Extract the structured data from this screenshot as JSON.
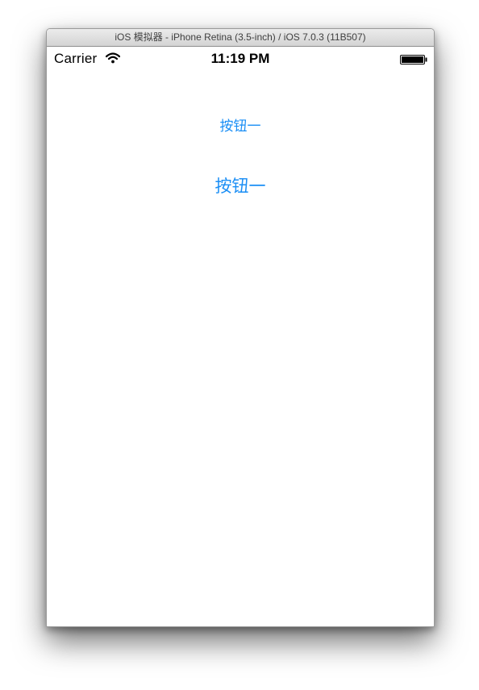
{
  "window": {
    "title": "iOS 模拟器 - iPhone Retina (3.5-inch) / iOS 7.0.3 (11B507)"
  },
  "statusbar": {
    "carrier": "Carrier",
    "time": "11:19 PM",
    "wifi_icon": "wifi-icon",
    "battery_icon": "battery-icon",
    "battery_level": 1.0
  },
  "buttons": {
    "first_label": "按钮一",
    "second_label": "按钮一"
  },
  "colors": {
    "tint": "#1a8ef5"
  }
}
